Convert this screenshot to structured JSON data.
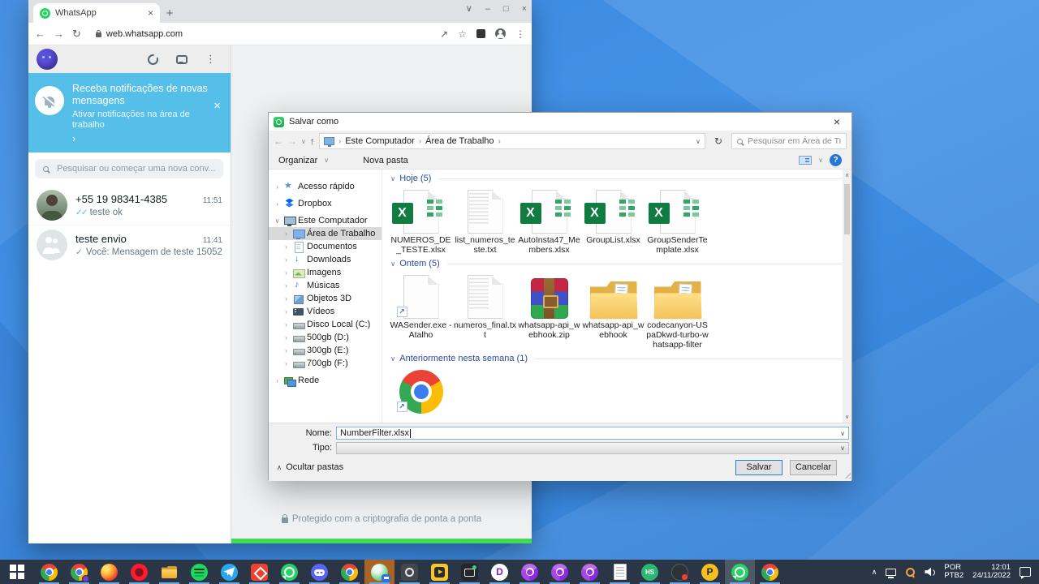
{
  "glyphs": {
    "back": "←",
    "forward": "→",
    "reload": "↻",
    "up": "↑",
    "chevron_down": "∨",
    "chevron_up": "∧",
    "chevron_right": "›",
    "close": "×",
    "minimize": "–",
    "maximize": "□",
    "menu_dots": "⋮",
    "plus": "+",
    "excel_x": "X",
    "shortcut_arrow": "↗",
    "help": "?",
    "scroll_up": "∧",
    "scroll_down": "∨"
  },
  "browser": {
    "tab_title": "WhatsApp",
    "url": "web.whatsapp.com"
  },
  "whatsapp": {
    "banner": {
      "title": "Receba notificações de novas mensagens",
      "subtitle": "Ativar notificações na área de trabalho",
      "chevron": "›"
    },
    "search_placeholder": "Pesquisar ou começar uma nova conv...",
    "chats": [
      {
        "name": "+55 19 98341-4385",
        "time": "11:51",
        "ticks": "✓✓",
        "tick_style": "blue",
        "preview": "teste ok",
        "avatar": "person-photo"
      },
      {
        "name": "teste envio",
        "time": "11:41",
        "ticks": "✓",
        "tick_style": "gray",
        "preview": "Você: Mensagem de teste 15052",
        "avatar": "group-default"
      }
    ],
    "footer": "Protegido com a criptografia de ponta a ponta"
  },
  "dialog": {
    "title": "Salvar como",
    "breadcrumb": {
      "sep": "›",
      "segments": [
        "Este Computador",
        "Área de Trabalho"
      ]
    },
    "search_placeholder": "Pesquisar em Área de Trabal...",
    "toolbar": {
      "organize": "Organizar",
      "new_folder": "Nova pasta"
    },
    "sidebar": [
      {
        "label": "Acesso rápido",
        "icon": "star",
        "level": 0,
        "expander": "›",
        "selected": false
      },
      {
        "label": "Dropbox",
        "icon": "dropbox",
        "level": 0,
        "expander": "›",
        "selected": false
      },
      {
        "label": "Este Computador",
        "icon": "pc",
        "level": 0,
        "expander": "∨",
        "selected": false
      },
      {
        "label": "Área de Trabalho",
        "icon": "desktop",
        "level": 1,
        "expander": "›",
        "selected": true
      },
      {
        "label": "Documentos",
        "icon": "doc",
        "level": 1,
        "expander": "›",
        "selected": false
      },
      {
        "label": "Downloads",
        "icon": "down",
        "level": 1,
        "expander": "›",
        "selected": false
      },
      {
        "label": "Imagens",
        "icon": "pic",
        "level": 1,
        "expander": "›",
        "selected": false
      },
      {
        "label": "Músicas",
        "icon": "music",
        "level": 1,
        "expander": "›",
        "selected": false
      },
      {
        "label": "Objetos 3D",
        "icon": "cube",
        "level": 1,
        "expander": "›",
        "selected": false
      },
      {
        "label": "Vídeos",
        "icon": "video",
        "level": 1,
        "expander": "›",
        "selected": false
      },
      {
        "label": "Disco Local (C:)",
        "icon": "drive",
        "level": 1,
        "expander": "›",
        "selected": false
      },
      {
        "label": "500gb (D:)",
        "icon": "drive",
        "level": 1,
        "expander": "›",
        "selected": false
      },
      {
        "label": "300gb (E:)",
        "icon": "drive",
        "level": 1,
        "expander": "›",
        "selected": false
      },
      {
        "label": "700gb (F:)",
        "icon": "drive",
        "level": 1,
        "expander": "›",
        "selected": false
      },
      {
        "label": "Rede",
        "icon": "net",
        "level": 0,
        "expander": "›",
        "selected": false
      }
    ],
    "groups": [
      {
        "label": "Hoje (5)",
        "chevron": "∨",
        "items": [
          {
            "name": "NUMEROS_DE_TESTE.xlsx",
            "type": "excel"
          },
          {
            "name": "list_numeros_teste.txt",
            "type": "txt"
          },
          {
            "name": "AutoInsta47_Members.xlsx",
            "type": "excel"
          },
          {
            "name": "GroupList.xlsx",
            "type": "excel"
          },
          {
            "name": "GroupSenderTemplate.xlsx",
            "type": "excel"
          }
        ]
      },
      {
        "label": "Ontem (5)",
        "chevron": "∨",
        "items": [
          {
            "name": "WASender.exe - Atalho",
            "type": "shortcut-blank"
          },
          {
            "name": "numeros_final.txt",
            "type": "txt"
          },
          {
            "name": "whatsapp-api_webhook.zip",
            "type": "rar"
          },
          {
            "name": "whatsapp-api_webhook",
            "type": "folder"
          },
          {
            "name": "codecanyon-USpaDkwd-turbo-whatsapp-filter",
            "type": "folder"
          }
        ]
      },
      {
        "label": "Anteriormente nesta semana (1)",
        "chevron": "∨",
        "items": [
          {
            "name": "",
            "type": "chrome-shortcut"
          }
        ]
      }
    ],
    "fields": {
      "name_label": "Nome:",
      "name_value": "NumberFilter.xlsx",
      "type_label": "Tipo:"
    },
    "hide_folders": "Ocultar pastas",
    "buttons": {
      "save": "Salvar",
      "cancel": "Cancelar"
    }
  },
  "taskbar": {
    "icons": [
      {
        "name": "start-button",
        "type": "win",
        "active": "",
        "label": ""
      },
      {
        "name": "chrome",
        "type": "chrome",
        "active": "",
        "label": ""
      },
      {
        "name": "chrome-profile",
        "type": "chrome-badge",
        "active": "",
        "label": ""
      },
      {
        "name": "firefox",
        "type": "firefox",
        "active": "",
        "label": ""
      },
      {
        "name": "opera",
        "type": "opera",
        "active": "",
        "label": ""
      },
      {
        "name": "file-explorer",
        "type": "explorer",
        "active": "",
        "label": ""
      },
      {
        "name": "spotify",
        "type": "spotify",
        "active": "",
        "label": ""
      },
      {
        "name": "telegram",
        "type": "telegram",
        "active": "",
        "label": ""
      },
      {
        "name": "anydesk",
        "type": "anydesk",
        "active": "",
        "label": ""
      },
      {
        "name": "whatsapp",
        "type": "whatsapp",
        "active": "",
        "label": ""
      },
      {
        "name": "discord",
        "type": "discord",
        "active": "",
        "label": ""
      },
      {
        "name": "chrome-2",
        "type": "chrome",
        "active": "",
        "label": ""
      },
      {
        "name": "wasender-app",
        "type": "wasender",
        "active": "orange",
        "label": ""
      },
      {
        "name": "camera-app",
        "type": "camera",
        "active": "",
        "label": ""
      },
      {
        "name": "media-studio-app",
        "type": "ytstudio",
        "active": "",
        "label": ""
      },
      {
        "name": "dark-chat-app",
        "type": "darkchat",
        "active": "",
        "label": ""
      },
      {
        "name": "purple-d-app",
        "type": "purpd",
        "active": "",
        "label": "D"
      },
      {
        "name": "purple-browser-1",
        "type": "purpchrome",
        "active": "",
        "label": ""
      },
      {
        "name": "purple-browser-2",
        "type": "purpchrome",
        "active": "",
        "label": ""
      },
      {
        "name": "purple-browser-3",
        "type": "purpchrome",
        "active": "",
        "label": ""
      },
      {
        "name": "notepad",
        "type": "notepad",
        "active": "",
        "label": ""
      },
      {
        "name": "hs-app",
        "type": "hs",
        "active": "",
        "label": "HS"
      },
      {
        "name": "screen-recorder",
        "type": "recorder",
        "active": "",
        "label": ""
      },
      {
        "name": "p-app",
        "type": "papp",
        "active": "",
        "label": "P"
      },
      {
        "name": "whatsapp-desktop",
        "type": "whatsapp",
        "active": "gray",
        "label": ""
      },
      {
        "name": "chrome-3",
        "type": "chrome",
        "active": "",
        "label": ""
      }
    ],
    "tray": {
      "lang_top": "POR",
      "lang_bottom": "PTB2",
      "time": "12:01",
      "date": "24/11/2022"
    }
  }
}
